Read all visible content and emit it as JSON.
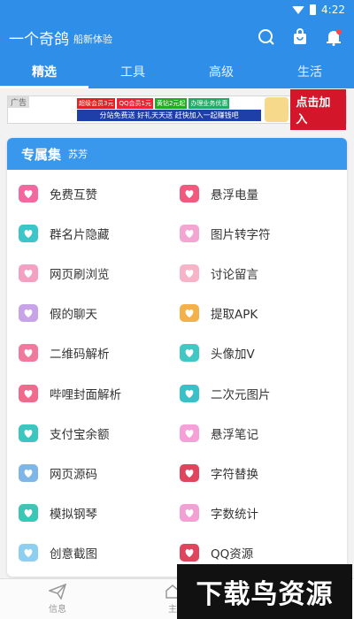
{
  "status": {
    "time": "4:22"
  },
  "appbar": {
    "title": "一个奇鸽",
    "subtitle": "船新体验"
  },
  "tabs": [
    {
      "label": "精选",
      "active": true
    },
    {
      "label": "工具",
      "active": false
    },
    {
      "label": "高级",
      "active": false
    },
    {
      "label": "生活",
      "active": false
    }
  ],
  "ad": {
    "label": "广告",
    "chips": [
      "超级会员3元",
      "QQ会员1元",
      "黄钻2元起",
      "办理业务优惠"
    ],
    "slogan": "分站免费送 好礼天天送 赶快加入一起赚钱吧",
    "cta": "点击加入"
  },
  "card": {
    "title": "专属集",
    "user": "苏芳"
  },
  "items": [
    {
      "label": "免费互赞",
      "icon": "hearts-arrow-icon",
      "color": "#f06aa0"
    },
    {
      "label": "悬浮电量",
      "icon": "winged-heart-icon",
      "color": "#f05a7e"
    },
    {
      "label": "群名片隐藏",
      "icon": "door-icon",
      "color": "#3cc6c9"
    },
    {
      "label": "图片转字符",
      "icon": "cake-icon",
      "color": "#f3a6d2"
    },
    {
      "label": "网页刷浏览",
      "icon": "globe-heart-icon",
      "color": "#f4a0c2"
    },
    {
      "label": "讨论留言",
      "icon": "birthday-cake-icon",
      "color": "#f7b3c8"
    },
    {
      "label": "假的聊天",
      "icon": "gift-box-icon",
      "color": "#c9a3e8"
    },
    {
      "label": "提取APK",
      "icon": "balloons-icon",
      "color": "#f4b04a"
    },
    {
      "label": "二维码解析",
      "icon": "perfume-icon",
      "color": "#f07a9e"
    },
    {
      "label": "头像加V",
      "icon": "van-icon",
      "color": "#41c7c4"
    },
    {
      "label": "哔哩封面解析",
      "icon": "heart-lollipops-icon",
      "color": "#f06a8e"
    },
    {
      "label": "二次元图片",
      "icon": "flower-bouquet-icon",
      "color": "#3ac0c8"
    },
    {
      "label": "支付宝余额",
      "icon": "shopping-bag-icon",
      "color": "#3cc6c0"
    },
    {
      "label": "悬浮笔记",
      "icon": "arrow-heart-icon",
      "color": "#f5a0d8"
    },
    {
      "label": "网页源码",
      "icon": "teddy-bear-icon",
      "color": "#7fb6e8"
    },
    {
      "label": "字符替换",
      "icon": "rose-vase-icon",
      "color": "#e0455e"
    },
    {
      "label": "模拟钢琴",
      "icon": "notebook-icon",
      "color": "#3cc6b6"
    },
    {
      "label": "字数统计",
      "icon": "ribbon-icon",
      "color": "#f3a0d4"
    },
    {
      "label": "创意截图",
      "icon": "baby-shirt-icon",
      "color": "#8ecff0"
    },
    {
      "label": "QQ资源",
      "icon": "rose-icon",
      "color": "#e0455e"
    }
  ],
  "bottom_nav": [
    {
      "label": "信息",
      "icon": "paper-plane-icon"
    },
    {
      "label": "主",
      "icon": "home-icon"
    }
  ],
  "watermark": "下载鸟资源",
  "colors": {
    "primary": "#2f8fe8",
    "card_header": "#3a98ec"
  }
}
